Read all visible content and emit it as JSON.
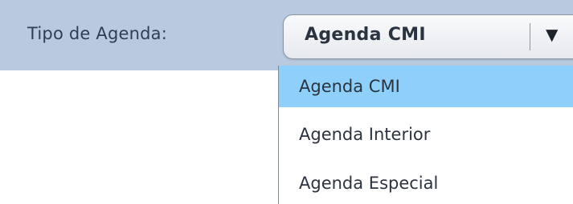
{
  "form": {
    "field_label": "Tipo de Agenda:",
    "selected_value": "Agenda CMI",
    "options": [
      {
        "label": "Agenda CMI",
        "selected": true
      },
      {
        "label": "Agenda Interior",
        "selected": false
      },
      {
        "label": "Agenda Especial",
        "selected": false
      }
    ]
  },
  "icons": {
    "dropdown_arrow": "▼"
  },
  "colors": {
    "header_background": "#b9c9df",
    "selected_option_background": "#8fd0fb",
    "text": "#2b3340"
  }
}
